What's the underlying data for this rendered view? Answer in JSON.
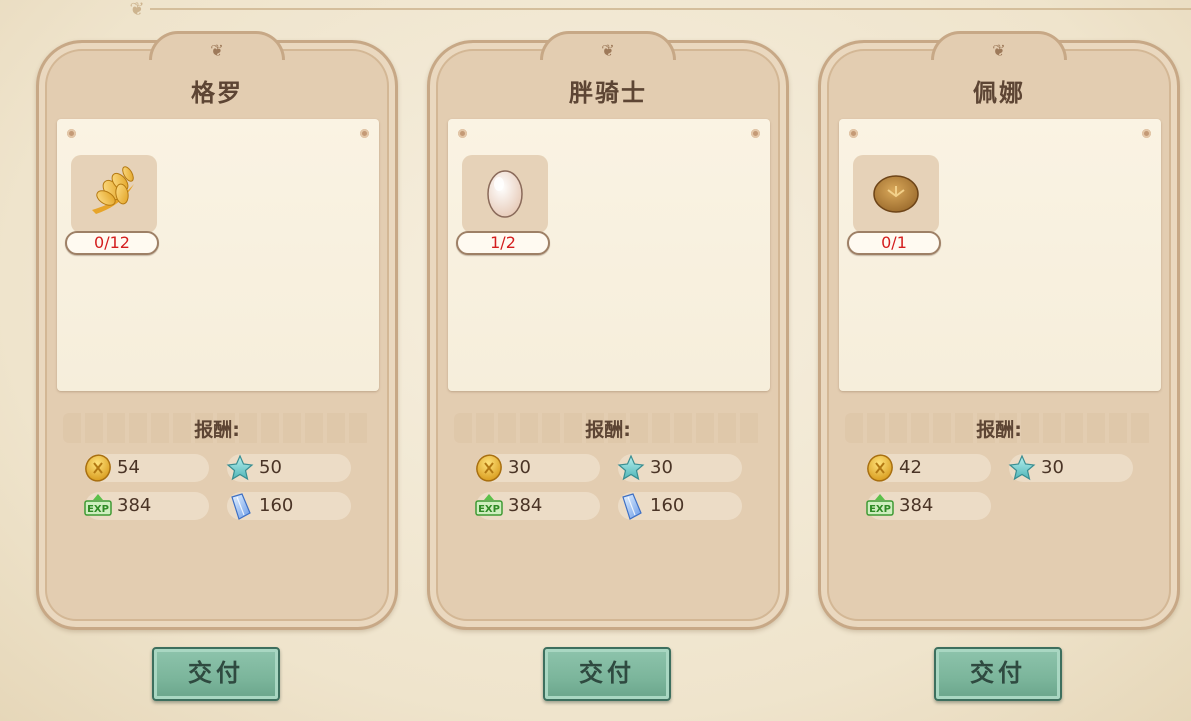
{
  "ui": {
    "reward_label": "报酬:",
    "submit_label": "交付"
  },
  "cards": [
    {
      "name": "格罗",
      "item_icon": "wheat-icon",
      "progress": "0/12",
      "rewards": [
        {
          "icon": "gold-coin-icon",
          "value": "54"
        },
        {
          "icon": "star-icon",
          "value": "50"
        },
        {
          "icon": "exp-icon",
          "value": "384"
        },
        {
          "icon": "crystal-icon",
          "value": "160"
        }
      ]
    },
    {
      "name": "胖骑士",
      "item_icon": "egg-icon",
      "progress": "1/2",
      "rewards": [
        {
          "icon": "gold-coin-icon",
          "value": "30"
        },
        {
          "icon": "star-icon",
          "value": "30"
        },
        {
          "icon": "exp-icon",
          "value": "384"
        },
        {
          "icon": "crystal-icon",
          "value": "160"
        }
      ]
    },
    {
      "name": "佩娜",
      "item_icon": "bread-icon",
      "progress": "0/1",
      "rewards": [
        {
          "icon": "gold-coin-icon",
          "value": "42"
        },
        {
          "icon": "star-icon",
          "value": "30"
        },
        {
          "icon": "exp-icon",
          "value": "384"
        }
      ]
    }
  ],
  "colors": {
    "progress_text": "#d41e1e",
    "button": "#7bb59b"
  }
}
